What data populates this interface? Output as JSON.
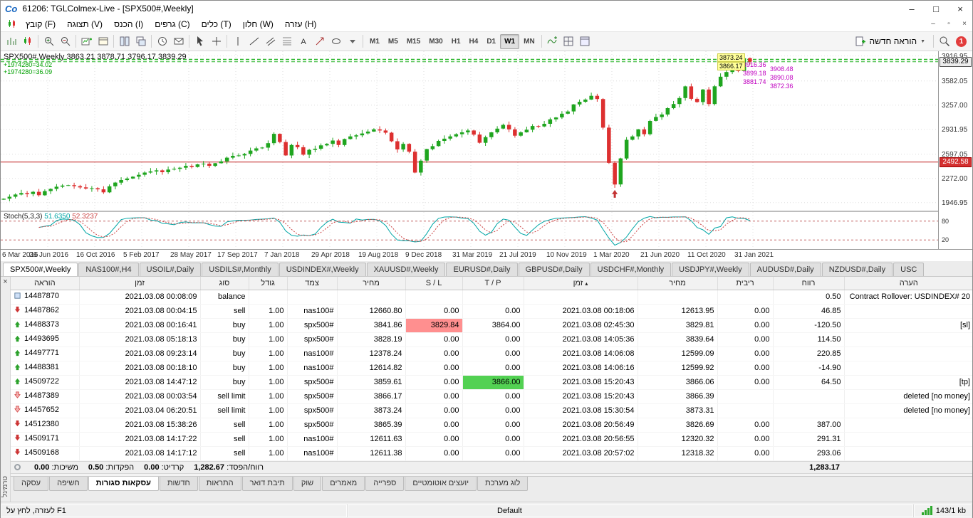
{
  "window": {
    "title": "61206: TGLColmex-Live - [SPX500#,Weekly]",
    "logo": "Co"
  },
  "menu": {
    "items": [
      {
        "id": "file",
        "label": "קובץ (F)"
      },
      {
        "id": "view",
        "label": "תצוגה (V)"
      },
      {
        "id": "insert",
        "label": "הכנס (I)"
      },
      {
        "id": "charts",
        "label": "גרפים (C)"
      },
      {
        "id": "tools",
        "label": "כלים (T)"
      },
      {
        "id": "window",
        "label": "חלון (W)"
      },
      {
        "id": "help",
        "label": "עזרה (H)"
      }
    ]
  },
  "toolbar": {
    "icons_left": [
      "bar-chart",
      "candle-chart",
      "sep",
      "zoom-in",
      "zoom-out",
      "sep",
      "new-chart",
      "profiles",
      "sep",
      "tile-windows",
      "cascade-windows",
      "sep",
      "clock",
      "export",
      "sep",
      "cursor",
      "crosshair",
      "sep",
      "vline",
      "trendline",
      "channel",
      "fibonacci",
      "text",
      "arrows",
      "ellipse",
      "shapes-more",
      "sep"
    ],
    "timeframes": [
      "M1",
      "M5",
      "M15",
      "M30",
      "H1",
      "H4",
      "D1",
      "W1",
      "MN"
    ],
    "active_timeframe": "W1",
    "icons_mid": [
      "sep",
      "indicators",
      "charts-grid",
      "templates"
    ],
    "new_order_label": "הוראה חדשה",
    "notification_count": "1"
  },
  "chart": {
    "type": "candlestick",
    "symbol_label": "SPX500#,Weekly",
    "ohlc": "3863.21 3878.71 3796.17 3839.29",
    "indicator_lines": [
      "+1974280=34.02",
      "+1974280=36.09"
    ],
    "price_axis": {
      "pmax": 3980,
      "pmin": 1840,
      "labels": [
        "3916.95",
        "3582.05",
        "3257.00",
        "2931.95",
        "2597.05",
        "2272.00",
        "1946.95"
      ],
      "current_price": "3839.29",
      "red_level": "2492.58"
    },
    "order_tags_magenta": [
      "3916.36",
      "3908.48",
      "3899.18",
      "3890.08",
      "3881.74",
      "3872.36"
    ],
    "order_tags_yellow": [
      "3873.24",
      "3866.17"
    ],
    "dashed_levels": [
      3839.29,
      3866.17,
      3873.24
    ],
    "red_line": 2492.58,
    "arrow_index": 104,
    "dates": [
      "6 Mar 2016",
      "26 Jun 2016",
      "16 Oct 2016",
      "5 Feb 2017",
      "28 May 2017",
      "17 Sep 2017",
      "7 Jan 2018",
      "29 Apr 2018",
      "19 Aug 2018",
      "9 Dec 2018",
      "31 Mar 2019",
      "21 Jul 2019",
      "10 Nov 2019",
      "1 Mar 2020",
      "21 Jun 2020",
      "11 Oct 2020",
      "31 Jan 2021"
    ],
    "closes": [
      2000,
      2026,
      2056,
      2076,
      2062,
      2092,
      2047,
      2102,
      2131,
      2161,
      2176,
      2182,
      2169,
      2152,
      2136,
      2141,
      2126,
      2086,
      2166,
      2216,
      2251,
      2271,
      2296,
      2321,
      2351,
      2366,
      2381,
      2356,
      2391,
      2401,
      2416,
      2441,
      2426,
      2461,
      2471,
      2441,
      2476,
      2501,
      2551,
      2576,
      2581,
      2601,
      2646,
      2676,
      2686,
      2746,
      2871,
      2761,
      2581,
      2721,
      2691,
      2591,
      2656,
      2671,
      2716,
      2736,
      2781,
      2721,
      2801,
      2836,
      2851,
      2876,
      2901,
      2931,
      2916,
      2886,
      2771,
      2661,
      2736,
      2631,
      2351,
      2511,
      2666,
      2706,
      2776,
      2806,
      2836,
      2866,
      2891,
      2916,
      2861,
      2751,
      2826,
      2891,
      2941,
      2991,
      2931,
      2846,
      2891,
      2926,
      2976,
      2971,
      3006,
      3066,
      3091,
      3141,
      3171,
      3266,
      3301,
      3331,
      3381,
      3338,
      2954,
      2481,
      2191,
      2541,
      2791,
      2836,
      2931,
      2866,
      3044,
      3097,
      3131,
      3216,
      3271,
      3351,
      3508,
      3341,
      3298,
      3466,
      3271,
      3509,
      3638,
      3701,
      3826,
      3714,
      3886,
      3839.29
    ],
    "stoch": {
      "label": "Stoch(5,3,3)",
      "k_value": "51.6350",
      "d_value": "52.3237",
      "levels": [
        80,
        20
      ]
    }
  },
  "chart_tabs": {
    "active": "SPX500#,Weekly",
    "items": [
      "SPX500#,Weekly",
      "NAS100#,H4",
      "USOIL#,Daily",
      "USDILS#,Monthly",
      "USDINDEX#,Weekly",
      "XAUUSD#,Weekly",
      "EURUSD#,Daily",
      "GBPUSD#,Daily",
      "USDCHF#,Monthly",
      "USDJPY#,Weekly",
      "AUDUSD#,Daily",
      "NZDUSD#,Daily",
      "USC"
    ]
  },
  "terminal": {
    "panel_label": "טרמינל",
    "columns": [
      "הוראה",
      "זמן",
      "סוג",
      "גודל",
      "צמד",
      "מחיר",
      "S / L",
      "T / P",
      "זמן",
      "מחיר",
      "ריבית",
      "רווח",
      "הערה"
    ],
    "sort_column": 8,
    "rows": [
      {
        "icon": "balance",
        "cells": [
          "14487870",
          "2021.03.08 00:08:09",
          "balance",
          "",
          "",
          "",
          "",
          "",
          "",
          "",
          "",
          "0.50",
          "Contract Rollover: USDINDEX# 20"
        ]
      },
      {
        "icon": "sell",
        "cells": [
          "14487862",
          "2021.03.08 00:04:15",
          "sell",
          "1.00",
          "nas100#",
          "12660.80",
          "0.00",
          "0.00",
          "2021.03.08 00:18:06",
          "12613.95",
          "0.00",
          "46.85",
          ""
        ]
      },
      {
        "icon": "buy",
        "hl": {
          "col": 6,
          "color": "red"
        },
        "cells": [
          "14488373",
          "2021.03.08 00:16:41",
          "buy",
          "1.00",
          "spx500#",
          "3841.86",
          "3829.84",
          "3864.00",
          "2021.03.08 02:45:30",
          "3829.81",
          "0.00",
          "-120.50",
          "[sl]"
        ]
      },
      {
        "icon": "buy",
        "cells": [
          "14493695",
          "2021.03.08 05:18:13",
          "buy",
          "1.00",
          "spx500#",
          "3828.19",
          "0.00",
          "0.00",
          "2021.03.08 14:05:36",
          "3839.64",
          "0.00",
          "114.50",
          ""
        ]
      },
      {
        "icon": "buy",
        "cells": [
          "14497771",
          "2021.03.08 09:23:14",
          "buy",
          "1.00",
          "nas100#",
          "12378.24",
          "0.00",
          "0.00",
          "2021.03.08 14:06:08",
          "12599.09",
          "0.00",
          "220.85",
          ""
        ]
      },
      {
        "icon": "buy",
        "cells": [
          "14488381",
          "2021.03.08 00:18:10",
          "buy",
          "1.00",
          "nas100#",
          "12614.82",
          "0.00",
          "0.00",
          "2021.03.08 14:06:16",
          "12599.92",
          "0.00",
          "-14.90",
          ""
        ]
      },
      {
        "icon": "buy",
        "hl": {
          "col": 7,
          "color": "green"
        },
        "cells": [
          "14509722",
          "2021.03.08 14:47:12",
          "buy",
          "1.00",
          "spx500#",
          "3859.61",
          "0.00",
          "3866.00",
          "2021.03.08 15:20:43",
          "3866.06",
          "0.00",
          "64.50",
          "[tp]"
        ]
      },
      {
        "icon": "sell-limit",
        "cells": [
          "14487389",
          "2021.03.08 00:03:54",
          "sell limit",
          "1.00",
          "spx500#",
          "3866.17",
          "0.00",
          "0.00",
          "2021.03.08 15:20:43",
          "3866.39",
          "",
          "",
          "deleted [no money]"
        ]
      },
      {
        "icon": "sell-limit",
        "cells": [
          "14457652",
          "2021.03.04 06:20:51",
          "sell limit",
          "1.00",
          "spx500#",
          "3873.24",
          "0.00",
          "0.00",
          "2021.03.08 15:30:54",
          "3873.31",
          "",
          "",
          "deleted [no money]"
        ]
      },
      {
        "icon": "sell",
        "cells": [
          "14512380",
          "2021.03.08 15:38:26",
          "sell",
          "1.00",
          "spx500#",
          "3865.39",
          "0.00",
          "0.00",
          "2021.03.08 20:56:49",
          "3826.69",
          "0.00",
          "387.00",
          ""
        ]
      },
      {
        "icon": "sell",
        "cells": [
          "14509171",
          "2021.03.08 14:17:22",
          "sell",
          "1.00",
          "nas100#",
          "12611.63",
          "0.00",
          "0.00",
          "2021.03.08 20:56:55",
          "12320.32",
          "0.00",
          "291.31",
          ""
        ]
      },
      {
        "icon": "sell",
        "cells": [
          "14509168",
          "2021.03.08 14:17:12",
          "sell",
          "1.00",
          "nas100#",
          "12611.38",
          "0.00",
          "0.00",
          "2021.03.08 20:57:02",
          "12318.32",
          "0.00",
          "293.06",
          ""
        ]
      }
    ],
    "summary": {
      "segments": [
        {
          "label": "רווח/הפסד",
          "value": "1,282.67"
        },
        {
          "label": "קרדיט",
          "value": "0.00"
        },
        {
          "label": "הפקדות",
          "value": "0.50"
        },
        {
          "label": "משיכות",
          "value": "0.00"
        }
      ],
      "total": "1,283.17"
    }
  },
  "bottom_tabs": {
    "active": "account-history",
    "items": [
      {
        "id": "trade",
        "label": "עסקה"
      },
      {
        "id": "exposure",
        "label": "חשיפה"
      },
      {
        "id": "account-history",
        "label": "עסקאות סגורות"
      },
      {
        "id": "news",
        "label": "חדשות"
      },
      {
        "id": "alerts",
        "label": "התראות"
      },
      {
        "id": "mailbox",
        "label": "תיבת דואר"
      },
      {
        "id": "market",
        "label": "שוק"
      },
      {
        "id": "articles",
        "label": "מאמרים"
      },
      {
        "id": "library",
        "label": "ספרייה"
      },
      {
        "id": "experts",
        "label": "יועצים אוטומטיים"
      },
      {
        "id": "journal",
        "label": "לוג מערכת"
      }
    ]
  },
  "status_bar": {
    "help": "לעזרה, לחץ על F1",
    "profile": "Default",
    "connection": "143/1 kb"
  }
}
